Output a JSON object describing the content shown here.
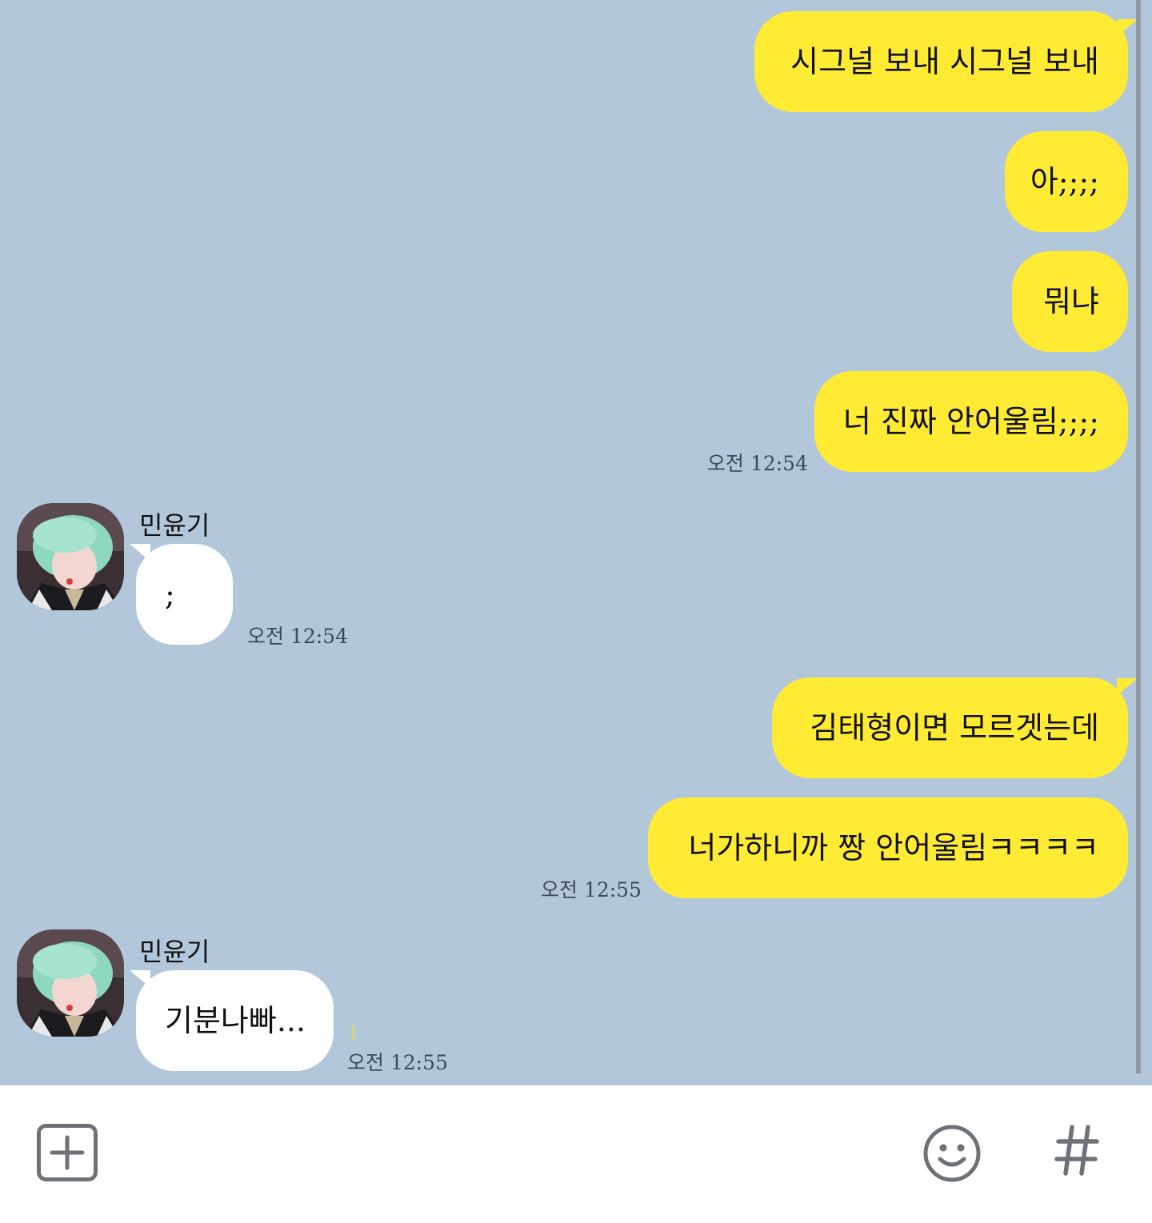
{
  "messages": {
    "m1": {
      "text": "시그널 보내 시그널 보내"
    },
    "m2": {
      "text": "아;;;;"
    },
    "m3": {
      "text": "뭐냐"
    },
    "m4": {
      "text": "너 진짜 안어울림;;;;",
      "time": "오전 12:54"
    },
    "m5": {
      "sender": "민윤기",
      "text": ";",
      "time": "오전 12:54"
    },
    "m6": {
      "text": "김태형이면 모르겟는데"
    },
    "m7": {
      "text": "너가하니까 짱 안어울림ㅋㅋㅋㅋ",
      "time": "오전 12:55"
    },
    "m8": {
      "sender": "민윤기",
      "text": "기분나빠...",
      "time": "오전 12:55",
      "unread": "1"
    }
  },
  "input_bar": {
    "plus_icon": "plus-square-icon",
    "emoji_icon": "smiley-icon",
    "hash_icon": "hashtag-icon"
  },
  "colors": {
    "chat_background": "#b2c7da",
    "my_bubble": "#ffeb33",
    "their_bubble": "#ffffff",
    "unread_count": "#e9e04a"
  }
}
